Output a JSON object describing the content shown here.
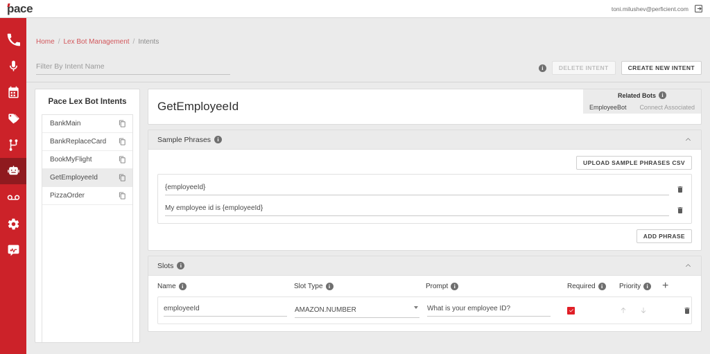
{
  "topbar": {
    "logo_text": "pace",
    "user_email": "toni.milushev@perficient.com",
    "logout_icon": "logout-icon"
  },
  "sidebar": {
    "items": [
      {
        "icon": "phone-icon",
        "name": "phone",
        "active": false
      },
      {
        "icon": "microphone-icon",
        "name": "microphone",
        "active": false
      },
      {
        "icon": "calendar-icon",
        "name": "calendar",
        "active": false
      },
      {
        "icon": "tags-icon",
        "name": "tags",
        "active": false
      },
      {
        "icon": "flow-branch-icon",
        "name": "flows",
        "active": false
      },
      {
        "icon": "robot-icon",
        "name": "lex-bots",
        "active": true
      },
      {
        "icon": "voicemail-icon",
        "name": "voicemail",
        "active": false
      },
      {
        "icon": "gear-icon",
        "name": "settings",
        "active": false
      },
      {
        "icon": "chat-pulse-icon",
        "name": "analytics",
        "active": false
      }
    ]
  },
  "breadcrumb": {
    "home": "Home",
    "sep": "/",
    "section": "Lex Bot Management",
    "current": "Intents"
  },
  "toolbar": {
    "filter_placeholder": "Filter By Intent Name",
    "filter_value": "",
    "info_char": "i",
    "delete_intent_label": "DELETE INTENT",
    "create_intent_label": "CREATE NEW INTENT"
  },
  "intent_list": {
    "title": "Pace Lex Bot Intents",
    "items": [
      {
        "label": "BankMain",
        "selected": false
      },
      {
        "label": "BankReplaceCard",
        "selected": false
      },
      {
        "label": "BookMyFlight",
        "selected": false
      },
      {
        "label": "GetEmployeeId",
        "selected": true
      },
      {
        "label": "PizzaOrder",
        "selected": false
      }
    ],
    "copy_icon": "copy-icon"
  },
  "detail": {
    "title": "GetEmployeeId",
    "related_bots": {
      "header": "Related Bots",
      "bot_name": "EmployeeBot",
      "status": "Connect Associated"
    }
  },
  "sample_phrases": {
    "title": "Sample Phrases",
    "upload_label": "UPLOAD SAMPLE PHRASES CSV",
    "add_label": "ADD PHRASE",
    "phrases": [
      {
        "value": "{employeeId}"
      },
      {
        "value": "My employee id is {employeeId}"
      }
    ],
    "delete_icon": "trash-icon",
    "collapse_icon": "chevron-up-icon"
  },
  "slots": {
    "title": "Slots",
    "columns": {
      "name": "Name",
      "slot_type": "Slot Type",
      "prompt": "Prompt",
      "required": "Required",
      "priority": "Priority"
    },
    "add_icon": "plus-icon",
    "collapse_icon": "chevron-up-icon",
    "rows": [
      {
        "name": "employeeId",
        "slot_type": "AMAZON.NUMBER",
        "prompt": "What is your employee ID?",
        "required": true,
        "up_icon": "arrow-up-icon",
        "down_icon": "arrow-down-icon",
        "delete_icon": "trash-icon"
      }
    ]
  },
  "colors": {
    "brand_red": "#cc2229",
    "active_red": "#8f1a1f",
    "checkbox_red": "#e01e26",
    "page_bg": "#ebebeb",
    "panel_bg": "#ffffff",
    "link_red": "#d2565b"
  }
}
